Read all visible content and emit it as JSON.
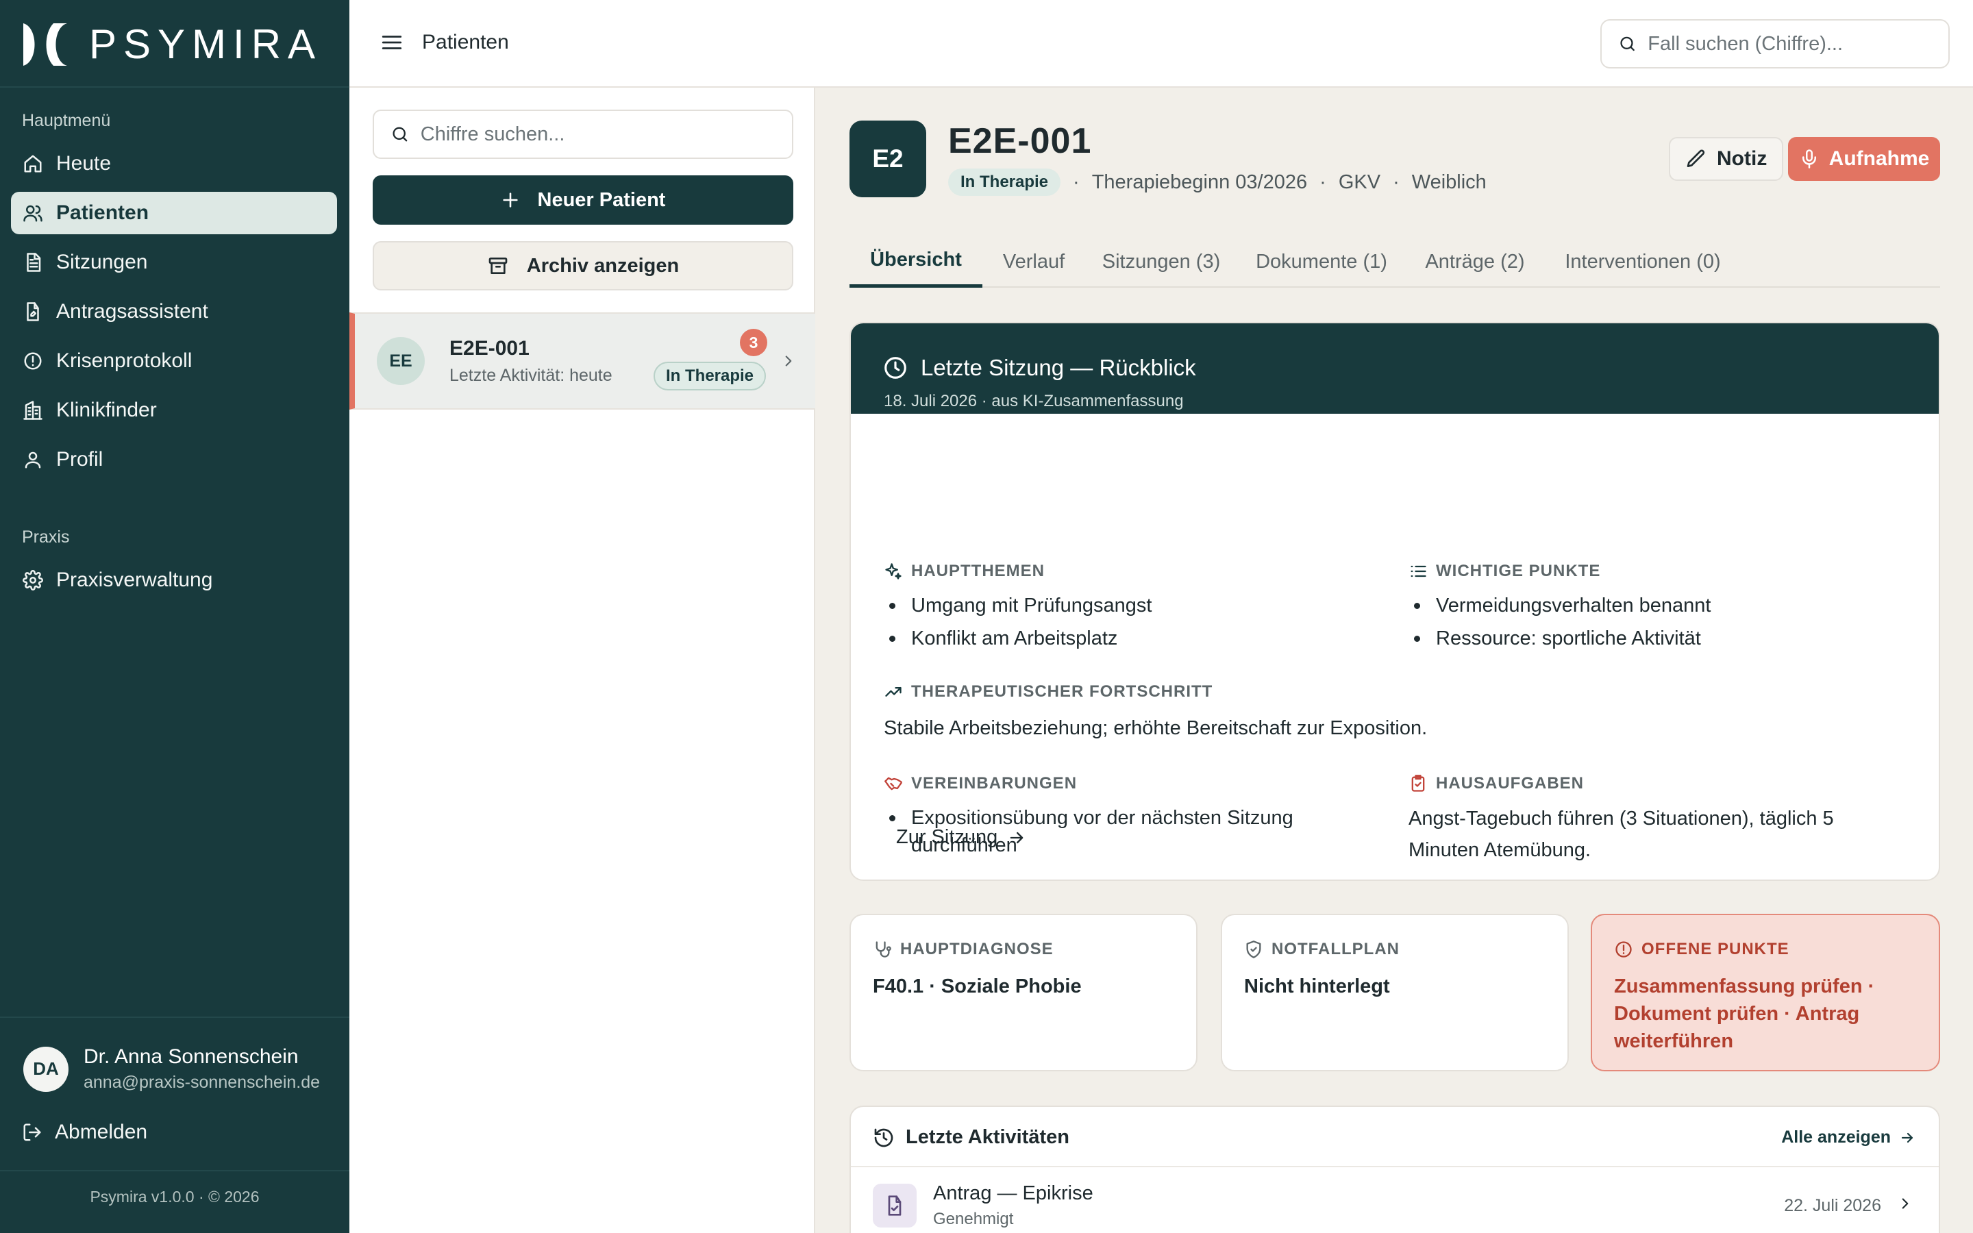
{
  "brand": {
    "name": "PSYMIRA"
  },
  "sidebar": {
    "section_main": "Hauptmenü",
    "items": [
      {
        "label": "Heute",
        "icon": "home-icon"
      },
      {
        "label": "Patienten",
        "icon": "users-icon",
        "active": true
      },
      {
        "label": "Sitzungen",
        "icon": "document-icon"
      },
      {
        "label": "Antragsassistent",
        "icon": "file-edit-icon"
      },
      {
        "label": "Krisenprotokoll",
        "icon": "alert-circle-icon"
      },
      {
        "label": "Klinikfinder",
        "icon": "building-icon"
      },
      {
        "label": "Profil",
        "icon": "user-icon"
      }
    ],
    "section_practice": "Praxis",
    "practice_items": [
      {
        "label": "Praxisverwaltung",
        "icon": "gear-icon"
      }
    ],
    "user": {
      "initials": "DA",
      "name": "Dr. Anna Sonnenschein",
      "email": "anna@praxis-sonnenschein.de"
    },
    "logout": "Abmelden",
    "version": "Psymira v1.0.0 · © 2026"
  },
  "topbar": {
    "title": "Patienten",
    "search_placeholder": "Fall suchen (Chiffre)..."
  },
  "patient_list": {
    "search_placeholder": "Chiffre suchen...",
    "new_button": "Neuer Patient",
    "archive_button": "Archiv anzeigen",
    "patients": [
      {
        "initials": "EE",
        "id": "E2E-001",
        "activity": "Letzte Aktivität: heute",
        "count": "3",
        "status": "In Therapie"
      }
    ]
  },
  "patient": {
    "avatar": "E2",
    "id": "E2E-001",
    "status": "In Therapie",
    "therapy_start": "Therapiebeginn 03/2026",
    "insurance": "GKV",
    "gender": "Weiblich",
    "separator": "·",
    "note_button": "Notiz",
    "record_button": "Aufnahme"
  },
  "tabs": [
    {
      "label": "Übersicht",
      "active": true
    },
    {
      "label": "Verlauf"
    },
    {
      "label": "Sitzungen (3)"
    },
    {
      "label": "Dokumente (1)"
    },
    {
      "label": "Anträge (2)"
    },
    {
      "label": "Interventionen (0)"
    }
  ],
  "review": {
    "title": "Letzte Sitzung — Rückblick",
    "subtitle": "18. Juli 2026 · aus KI-Zusammenfassung",
    "main_topics_label": "HAUPTTHEMEN",
    "main_topics": [
      "Umgang mit Prüfungsangst",
      "Konflikt am Arbeitsplatz"
    ],
    "key_points_label": "WICHTIGE PUNKTE",
    "key_points": [
      "Vermeidungsverhalten benannt",
      "Ressource: sportliche Aktivität"
    ],
    "progress_label": "THERAPEUTISCHER FORTSCHRITT",
    "progress_text": "Stabile Arbeitsbeziehung; erhöhte Bereitschaft zur Exposition.",
    "agreements_label": "VEREINBARUNGEN",
    "agreements": [
      "Expositionsübung vor der nächsten Sitzung durchführen"
    ],
    "homework_label": "HAUSAUFGABEN",
    "homework_text": "Angst-Tagebuch führen (3 Situationen), täglich 5 Minuten Atemübung.",
    "link": "Zur Sitzung"
  },
  "info_cards": {
    "diagnosis": {
      "label": "HAUPTDIAGNOSE",
      "value": "F40.1 · Soziale Phobie"
    },
    "emergency": {
      "label": "NOTFALLPLAN",
      "value": "Nicht hinterlegt"
    },
    "open": {
      "label": "OFFENE PUNKTE",
      "value": "Zusammenfassung prüfen · Dokument prüfen · Antrag weiterführen"
    }
  },
  "activities": {
    "title": "Letzte Aktivitäten",
    "show_all": "Alle anzeigen",
    "items": [
      {
        "title": "Antrag — Epikrise",
        "subtitle": "Genehmigt",
        "date": "22. Juli 2026"
      }
    ]
  },
  "colors": {
    "sidebar": "#183a3d",
    "accent": "#e27462",
    "background": "#f2efe9",
    "alert_bg": "#f8ddd7",
    "alert_text": "#b2402f"
  }
}
